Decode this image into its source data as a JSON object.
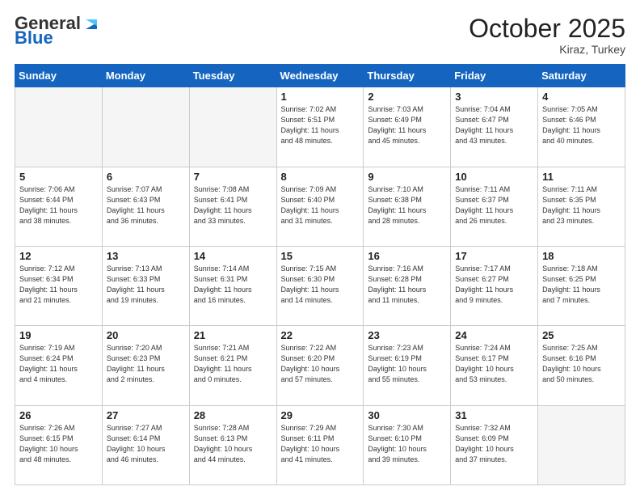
{
  "header": {
    "logo_general": "General",
    "logo_blue": "Blue",
    "month_title": "October 2025",
    "location": "Kiraz, Turkey"
  },
  "days_of_week": [
    "Sunday",
    "Monday",
    "Tuesday",
    "Wednesday",
    "Thursday",
    "Friday",
    "Saturday"
  ],
  "weeks": [
    [
      {
        "day": "",
        "info": ""
      },
      {
        "day": "",
        "info": ""
      },
      {
        "day": "",
        "info": ""
      },
      {
        "day": "1",
        "info": "Sunrise: 7:02 AM\nSunset: 6:51 PM\nDaylight: 11 hours\nand 48 minutes."
      },
      {
        "day": "2",
        "info": "Sunrise: 7:03 AM\nSunset: 6:49 PM\nDaylight: 11 hours\nand 45 minutes."
      },
      {
        "day": "3",
        "info": "Sunrise: 7:04 AM\nSunset: 6:47 PM\nDaylight: 11 hours\nand 43 minutes."
      },
      {
        "day": "4",
        "info": "Sunrise: 7:05 AM\nSunset: 6:46 PM\nDaylight: 11 hours\nand 40 minutes."
      }
    ],
    [
      {
        "day": "5",
        "info": "Sunrise: 7:06 AM\nSunset: 6:44 PM\nDaylight: 11 hours\nand 38 minutes."
      },
      {
        "day": "6",
        "info": "Sunrise: 7:07 AM\nSunset: 6:43 PM\nDaylight: 11 hours\nand 36 minutes."
      },
      {
        "day": "7",
        "info": "Sunrise: 7:08 AM\nSunset: 6:41 PM\nDaylight: 11 hours\nand 33 minutes."
      },
      {
        "day": "8",
        "info": "Sunrise: 7:09 AM\nSunset: 6:40 PM\nDaylight: 11 hours\nand 31 minutes."
      },
      {
        "day": "9",
        "info": "Sunrise: 7:10 AM\nSunset: 6:38 PM\nDaylight: 11 hours\nand 28 minutes."
      },
      {
        "day": "10",
        "info": "Sunrise: 7:11 AM\nSunset: 6:37 PM\nDaylight: 11 hours\nand 26 minutes."
      },
      {
        "day": "11",
        "info": "Sunrise: 7:11 AM\nSunset: 6:35 PM\nDaylight: 11 hours\nand 23 minutes."
      }
    ],
    [
      {
        "day": "12",
        "info": "Sunrise: 7:12 AM\nSunset: 6:34 PM\nDaylight: 11 hours\nand 21 minutes."
      },
      {
        "day": "13",
        "info": "Sunrise: 7:13 AM\nSunset: 6:33 PM\nDaylight: 11 hours\nand 19 minutes."
      },
      {
        "day": "14",
        "info": "Sunrise: 7:14 AM\nSunset: 6:31 PM\nDaylight: 11 hours\nand 16 minutes."
      },
      {
        "day": "15",
        "info": "Sunrise: 7:15 AM\nSunset: 6:30 PM\nDaylight: 11 hours\nand 14 minutes."
      },
      {
        "day": "16",
        "info": "Sunrise: 7:16 AM\nSunset: 6:28 PM\nDaylight: 11 hours\nand 11 minutes."
      },
      {
        "day": "17",
        "info": "Sunrise: 7:17 AM\nSunset: 6:27 PM\nDaylight: 11 hours\nand 9 minutes."
      },
      {
        "day": "18",
        "info": "Sunrise: 7:18 AM\nSunset: 6:25 PM\nDaylight: 11 hours\nand 7 minutes."
      }
    ],
    [
      {
        "day": "19",
        "info": "Sunrise: 7:19 AM\nSunset: 6:24 PM\nDaylight: 11 hours\nand 4 minutes."
      },
      {
        "day": "20",
        "info": "Sunrise: 7:20 AM\nSunset: 6:23 PM\nDaylight: 11 hours\nand 2 minutes."
      },
      {
        "day": "21",
        "info": "Sunrise: 7:21 AM\nSunset: 6:21 PM\nDaylight: 11 hours\nand 0 minutes."
      },
      {
        "day": "22",
        "info": "Sunrise: 7:22 AM\nSunset: 6:20 PM\nDaylight: 10 hours\nand 57 minutes."
      },
      {
        "day": "23",
        "info": "Sunrise: 7:23 AM\nSunset: 6:19 PM\nDaylight: 10 hours\nand 55 minutes."
      },
      {
        "day": "24",
        "info": "Sunrise: 7:24 AM\nSunset: 6:17 PM\nDaylight: 10 hours\nand 53 minutes."
      },
      {
        "day": "25",
        "info": "Sunrise: 7:25 AM\nSunset: 6:16 PM\nDaylight: 10 hours\nand 50 minutes."
      }
    ],
    [
      {
        "day": "26",
        "info": "Sunrise: 7:26 AM\nSunset: 6:15 PM\nDaylight: 10 hours\nand 48 minutes."
      },
      {
        "day": "27",
        "info": "Sunrise: 7:27 AM\nSunset: 6:14 PM\nDaylight: 10 hours\nand 46 minutes."
      },
      {
        "day": "28",
        "info": "Sunrise: 7:28 AM\nSunset: 6:13 PM\nDaylight: 10 hours\nand 44 minutes."
      },
      {
        "day": "29",
        "info": "Sunrise: 7:29 AM\nSunset: 6:11 PM\nDaylight: 10 hours\nand 41 minutes."
      },
      {
        "day": "30",
        "info": "Sunrise: 7:30 AM\nSunset: 6:10 PM\nDaylight: 10 hours\nand 39 minutes."
      },
      {
        "day": "31",
        "info": "Sunrise: 7:32 AM\nSunset: 6:09 PM\nDaylight: 10 hours\nand 37 minutes."
      },
      {
        "day": "",
        "info": ""
      }
    ]
  ]
}
